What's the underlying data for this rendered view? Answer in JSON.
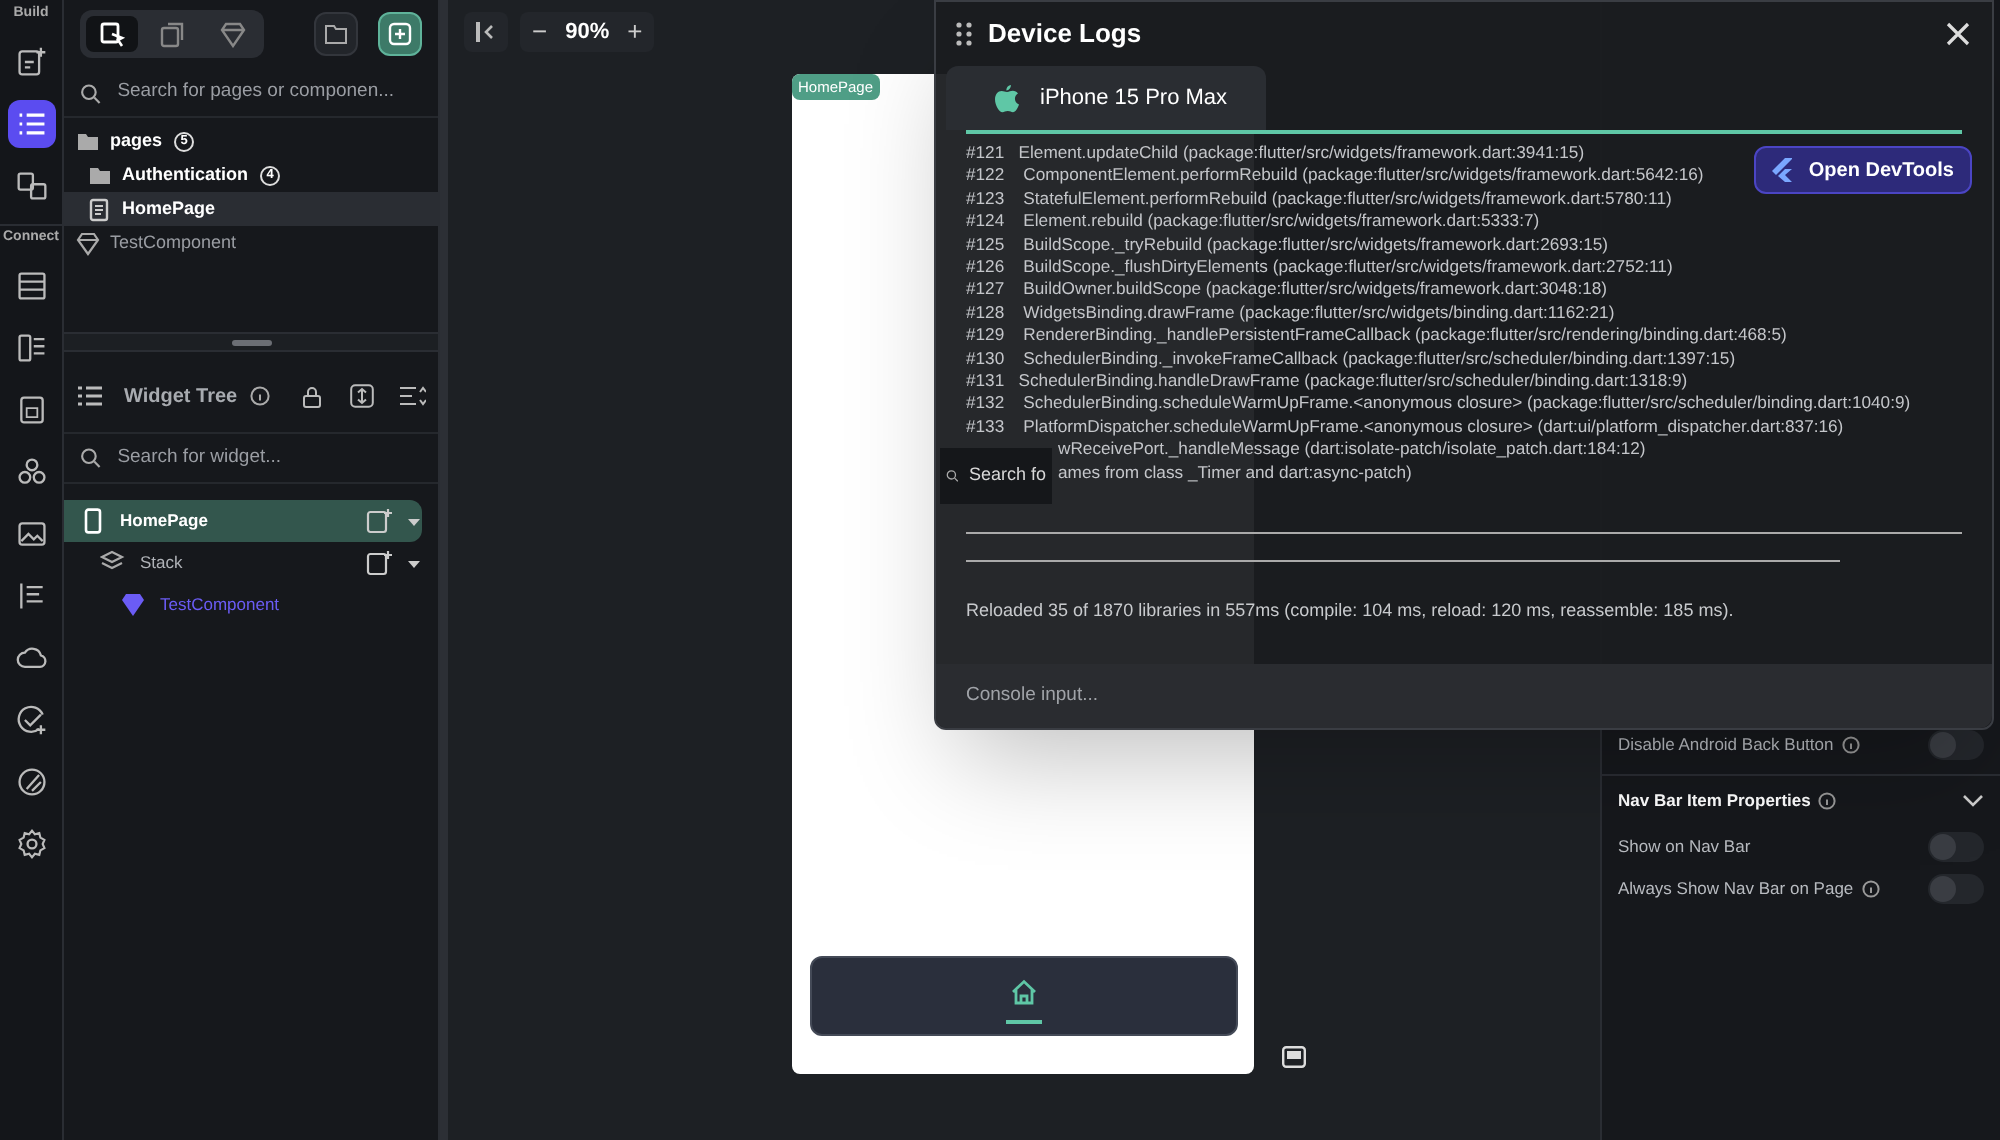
{
  "rail": [
    {
      "kind": "label",
      "text": "Build"
    },
    {
      "kind": "icon",
      "selected": false
    },
    {
      "kind": "icon",
      "selected": true
    },
    {
      "kind": "icon",
      "selected": false
    },
    {
      "kind": "label",
      "text": "Connect"
    },
    {
      "kind": "icon",
      "selected": false
    },
    {
      "kind": "icon",
      "selected": false
    },
    {
      "kind": "icon",
      "selected": false
    },
    {
      "kind": "icon",
      "selected": false
    },
    {
      "kind": "icon",
      "selected": false
    },
    {
      "kind": "icon",
      "selected": false
    },
    {
      "kind": "icon",
      "selected": false
    },
    {
      "kind": "icon",
      "selected": false
    },
    {
      "kind": "icon",
      "selected": false
    },
    {
      "kind": "icon",
      "selected": false
    }
  ],
  "navigator": {
    "tabs": [
      {
        "selected": true
      },
      {
        "selected": false
      },
      {
        "selected": false
      }
    ],
    "search": {
      "placeholder": "Search for pages or componen..."
    },
    "tree": [
      {
        "kind": "folder",
        "label": "pages",
        "count": "5",
        "selected": false,
        "children": [
          {
            "kind": "folder",
            "label": "Authentication",
            "count": "4",
            "selected": false
          },
          {
            "kind": "page",
            "label": "HomePage",
            "selected": true
          }
        ]
      },
      {
        "kind": "component",
        "label": "TestComponent",
        "selected": false
      }
    ]
  },
  "widget_tree": {
    "title": "Widget Tree",
    "search": {
      "placeholder": "Search for widget..."
    },
    "items": [
      {
        "kind": "page",
        "label": "HomePage",
        "selected": true,
        "children": [
          {
            "kind": "stack",
            "label": "Stack",
            "selected": false,
            "children": [
              {
                "kind": "component",
                "label": "TestComponent",
                "selected": false
              }
            ]
          }
        ]
      }
    ]
  },
  "canvas_toolbar": {
    "zoom": "90%",
    "minus": "−",
    "plus": "+"
  },
  "device_frame": {
    "page_label": "HomePage"
  },
  "device_logs": {
    "title": "Device Logs",
    "device": "iPhone 15 Pro Max",
    "devtools_button": "Open DevTools",
    "lines": [
      "#121   Element.updateChild (package:flutter/src/widgets/framework.dart:3941:15)",
      "#122    ComponentElement.performRebuild (package:flutter/src/widgets/framework.dart:5642:16)",
      "#123    StatefulElement.performRebuild (package:flutter/src/widgets/framework.dart:5780:11)",
      "#124    Element.rebuild (package:flutter/src/widgets/framework.dart:5333:7)",
      "#125    BuildScope._tryRebuild (package:flutter/src/widgets/framework.dart:2693:15)",
      "#126    BuildScope._flushDirtyElements (package:flutter/src/widgets/framework.dart:2752:11)",
      "#127    BuildOwner.buildScope (package:flutter/src/widgets/framework.dart:3048:18)",
      "#128    WidgetsBinding.drawFrame (package:flutter/src/widgets/binding.dart:1162:21)",
      "#129    RendererBinding._handlePersistentFrameCallback (package:flutter/src/rendering/binding.dart:468:5)",
      "#130    SchedulerBinding._invokeFrameCallback (package:flutter/src/scheduler/binding.dart:1397:15)",
      "#131   SchedulerBinding.handleDrawFrame (package:flutter/src/scheduler/binding.dart:1318:9)",
      "#132    SchedulerBinding.scheduleWarmUpFrame.<anonymous closure> (package:flutter/src/scheduler/binding.dart:1040:9)",
      "#133    PlatformDispatcher.scheduleWarmUpFrame.<anonymous closure> (dart:ui/platform_dispatcher.dart:837:16)"
    ],
    "lines_beside_search": [
      "wReceivePort._handleMessage (dart:isolate-patch/isolate_patch.dart:184:12)",
      "ames from class _Timer and dart:async-patch)"
    ],
    "summary": "Reloaded 35 of 1870 libraries in 557ms (compile: 104 ms, reload: 120 ms, reassemble: 185 ms).",
    "console": {
      "placeholder": "Console input..."
    },
    "search_popup": "Search fo"
  },
  "properties": [
    {
      "kind": "toggle",
      "label": "Disable Android Back Button",
      "info": true,
      "on": false
    },
    {
      "kind": "section",
      "label": "Nav Bar Item Properties",
      "info": true,
      "expanded": true
    },
    {
      "kind": "toggle",
      "label": "Show on Nav Bar",
      "info": false,
      "on": false
    },
    {
      "kind": "toggle",
      "label": "Always Show Nav Bar on Page",
      "info": true,
      "on": false
    }
  ]
}
